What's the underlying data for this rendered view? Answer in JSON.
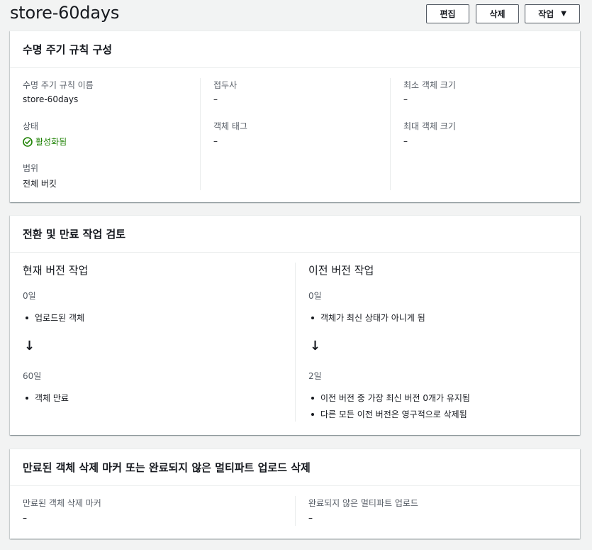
{
  "page": {
    "title": "store-60days",
    "buttons": {
      "edit": "편집",
      "delete": "삭제",
      "actions": "작업",
      "actions_caret": "▼"
    }
  },
  "config": {
    "title": "수명 주기 규칙 구성",
    "rule_name_label": "수명 주기 규칙 이름",
    "rule_name_value": "store-60days",
    "status_label": "상태",
    "status_value": "활성화됨",
    "scope_label": "범위",
    "scope_value": "전체 버킷",
    "prefix_label": "접두사",
    "prefix_value": "–",
    "tag_label": "객체 태그",
    "tag_value": "–",
    "min_size_label": "최소 객체 크기",
    "min_size_value": "–",
    "max_size_label": "최대 객체 크기",
    "max_size_value": "–"
  },
  "review": {
    "title": "전환 및 만료 작업 검토",
    "current": {
      "heading": "현재 버전 작업",
      "day0": "0일",
      "item0": "업로드된 객체",
      "day1": "60일",
      "item1": "객체 만료"
    },
    "previous": {
      "heading": "이전 버전 작업",
      "day0": "0일",
      "item0": "객체가 최신 상태가 아니게 됨",
      "day1": "2일",
      "item1": "이전 버전 중 가장 최신 버전 0개가 유지됨",
      "item2": "다른 모든 이전 버전은 영구적으로 삭제됨"
    },
    "arrow": "↓"
  },
  "cleanup": {
    "title": "만료된 객체 삭제 마커 또는 완료되지 않은 멀티파트 업로드 삭제",
    "markers_label": "만료된 객체 삭제 마커",
    "markers_value": "–",
    "multipart_label": "완료되지 않은 멀티파트 업로드",
    "multipart_value": "–"
  },
  "colors": {
    "success": "#1d8102",
    "border": "#eaeded",
    "muted": "#545b64"
  },
  "icons": {
    "status": "check-circle-icon",
    "actions": "caret-down-icon",
    "flow": "arrow-down-icon"
  }
}
